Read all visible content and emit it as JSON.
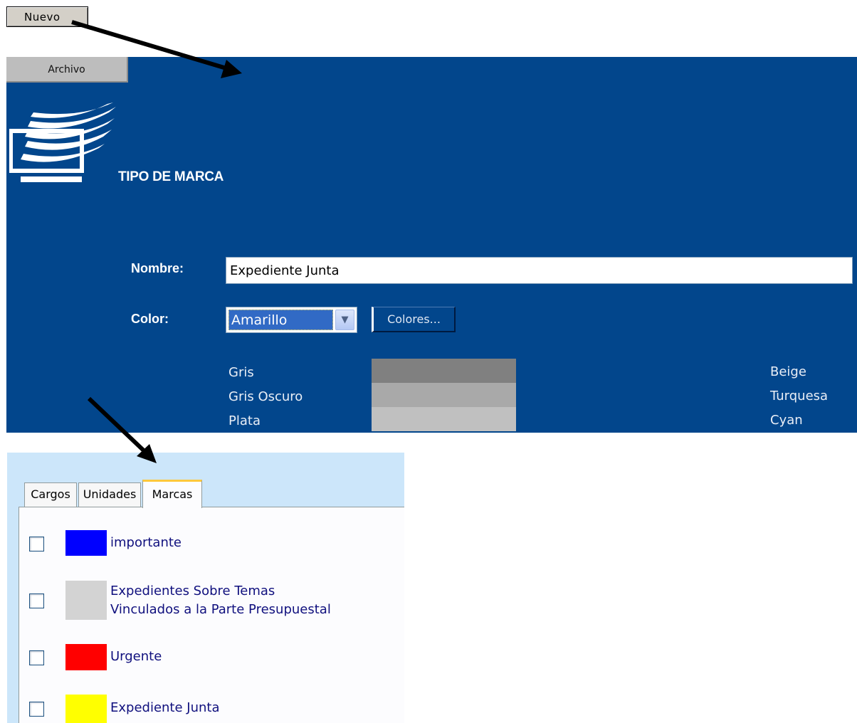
{
  "toolbar": {
    "new_label": "Nuevo"
  },
  "panel": {
    "archivo_tab": "Archivo",
    "title": "TIPO DE MARCA",
    "form": {
      "nombre_label": "Nombre:",
      "nombre_value": "Expediente Junta",
      "color_label": "Color:",
      "color_selected": "Amarillo",
      "colores_button": "Colores..."
    },
    "color_list_left": [
      {
        "name": "Gris",
        "swatch": "#808080"
      },
      {
        "name": "Gris Oscuro",
        "swatch": "#a9a9a9"
      },
      {
        "name": "Plata",
        "swatch": "#c0c0c0"
      }
    ],
    "color_list_right": [
      "Beige",
      "Turquesa",
      "Cyan"
    ],
    "bg_color": "#02468c"
  },
  "tabs": {
    "items": [
      "Cargos",
      "Unidades",
      "Marcas"
    ],
    "active": "Marcas"
  },
  "marks": [
    {
      "color": "#0000ff",
      "label_lines": [
        "importante"
      ]
    },
    {
      "color": "#d3d3d3",
      "label_lines": [
        "Expedientes Sobre Temas",
        "Vinculados a la Parte Presupuestal"
      ]
    },
    {
      "color": "#ff0000",
      "label_lines": [
        "Urgente"
      ]
    },
    {
      "color": "#ffff00",
      "label_lines": [
        "Expediente Junta"
      ]
    }
  ]
}
